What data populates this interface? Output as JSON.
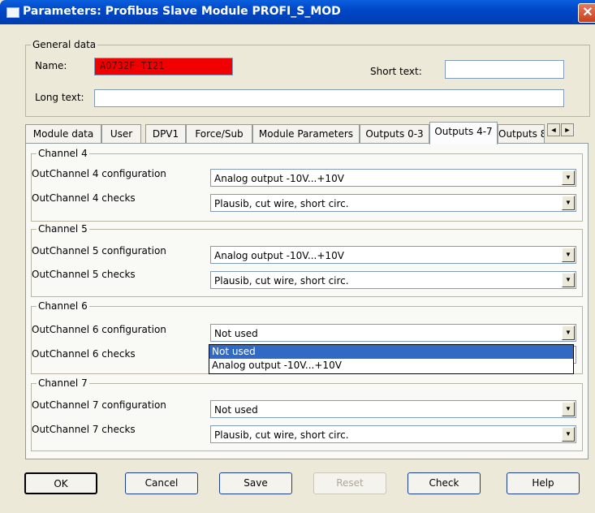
{
  "window": {
    "title": "Parameters: Profibus Slave Module PROFI_S_MOD",
    "close_label": "✕"
  },
  "general": {
    "legend": "General data",
    "name_label": "Name:",
    "name_value": "AO732F-TI21",
    "short_text_label": "Short text:",
    "short_text_value": "",
    "long_text_label": "Long text:",
    "long_text_value": ""
  },
  "tabs": [
    {
      "label": "Module data"
    },
    {
      "label": "User"
    },
    {
      "label": "DPV1"
    },
    {
      "label": "Force/Sub"
    },
    {
      "label": "Module Parameters"
    },
    {
      "label": "Outputs 0-3"
    },
    {
      "label": "Outputs 4-7"
    },
    {
      "label": "Outputs 8"
    }
  ],
  "active_tab": "Outputs 4-7",
  "tab_scroll": {
    "left": "◄",
    "right": "►"
  },
  "channels": [
    {
      "legend": "Channel 4",
      "config_label": "OutChannel 4 configuration",
      "config_value": "Analog output -10V...+10V",
      "checks_label": "OutChannel 4 checks",
      "checks_value": "Plausib, cut wire, short circ."
    },
    {
      "legend": "Channel 5",
      "config_label": "OutChannel 5 configuration",
      "config_value": "Analog output -10V...+10V",
      "checks_label": "OutChannel 5 checks",
      "checks_value": "Plausib, cut wire, short circ."
    },
    {
      "legend": "Channel 6",
      "config_label": "OutChannel 6 configuration",
      "config_value": "Not used",
      "checks_label": "OutChannel 6 checks",
      "checks_value": ""
    },
    {
      "legend": "Channel 7",
      "config_label": "OutChannel 7 configuration",
      "config_value": "Not used",
      "checks_label": "OutChannel 7 checks",
      "checks_value": "Plausib, cut wire, short circ."
    }
  ],
  "dropdown_arrow": "▼",
  "open_dropdown": {
    "options": [
      "Not used",
      "Analog output -10V...+10V"
    ],
    "selected_index": 0
  },
  "buttons": {
    "ok": "OK",
    "cancel": "Cancel",
    "save": "Save",
    "reset": "Reset",
    "check": "Check",
    "help": "Help"
  }
}
